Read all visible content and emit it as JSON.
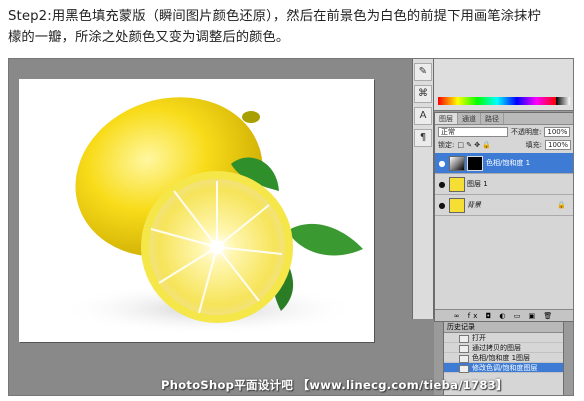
{
  "caption": {
    "line1": "Step2:用黑色填充蒙版（瞬间图片颜色还原），然后在前景色为白色的前提下用画笔涂抹柠",
    "line2": "檬的一瓣，所涂之处颜色又变为调整后的颜色。"
  },
  "layers_panel": {
    "tabs": [
      "图层",
      "通道",
      "路径"
    ],
    "blend_mode": "正常",
    "opacity_label": "不透明度:",
    "opacity_value": "100%",
    "lock_label": "锁定:",
    "fill_label": "填充:",
    "fill_value": "100%",
    "layers": [
      {
        "name": "色相/饱和度 1",
        "type": "adjustment",
        "active": true
      },
      {
        "name": "图层 1",
        "type": "image",
        "active": false
      },
      {
        "name": "背景",
        "type": "background",
        "active": false
      }
    ]
  },
  "history_panel": {
    "title": "历史记录",
    "items": [
      "打开",
      "通过拷贝的图层",
      "色相/饱和度 1图层",
      "修改色调/饱和度图层",
      "",
      ""
    ],
    "active_index": 4
  },
  "watermark": "PhotoShop平面设计吧 【www.linecg.com/tieba/1783】",
  "colors": {
    "accent": "#3d7bd4",
    "lemon": "#f6d91b",
    "leaf": "#2f8f2a"
  }
}
